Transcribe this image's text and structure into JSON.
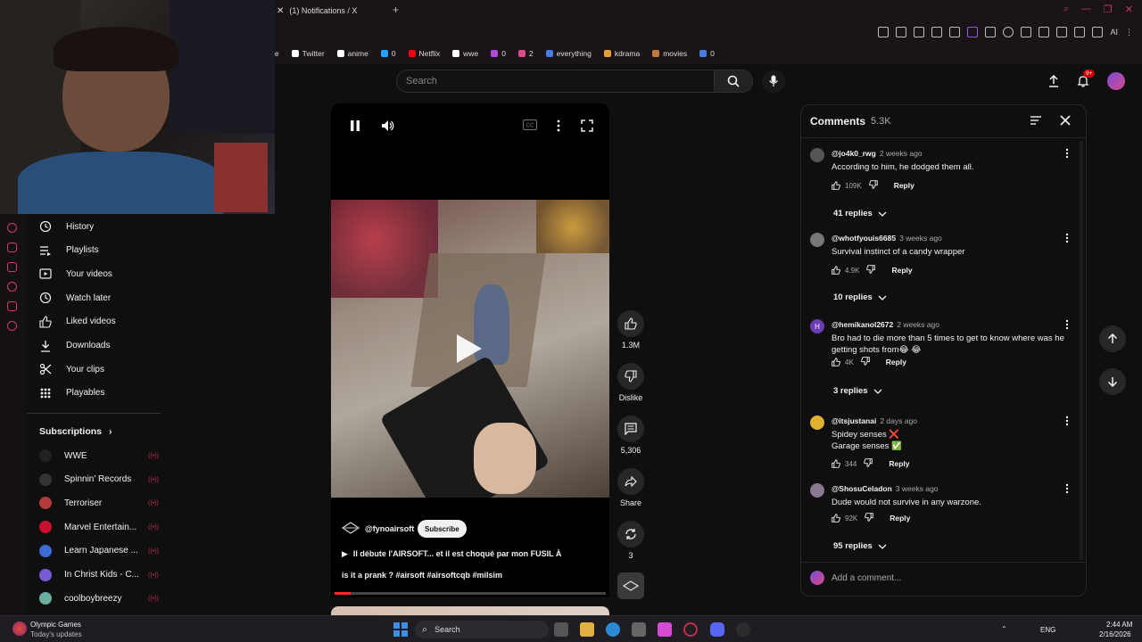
{
  "browser": {
    "tab_title": "(1) Notifications / X",
    "bookmarks": [
      {
        "label": "Twitter",
        "color": "#ffffff"
      },
      {
        "label": "anime",
        "color": "#ffffff"
      },
      {
        "label": "0",
        "color": "#2aa0ff"
      },
      {
        "label": "Netflix",
        "color": "#e50914"
      },
      {
        "label": "wwe",
        "color": "#ffffff"
      },
      {
        "label": "0",
        "color": "#b04bd6"
      },
      {
        "label": "2",
        "color": "#d64b8a"
      },
      {
        "label": "everything",
        "color": "#4b7bd6"
      },
      {
        "label": "kdrama",
        "color": "#e0a040"
      },
      {
        "label": "movies",
        "color": "#c07a40"
      },
      {
        "label": "0",
        "color": "#4b7bd6"
      }
    ],
    "ai_label": "AI"
  },
  "search": {
    "placeholder": "Search"
  },
  "notifications_badge": "9+",
  "sidebar": {
    "items": [
      {
        "label": "History",
        "icon": "history-icon"
      },
      {
        "label": "Playlists",
        "icon": "playlists-icon"
      },
      {
        "label": "Your videos",
        "icon": "your-videos-icon"
      },
      {
        "label": "Watch later",
        "icon": "watch-later-icon"
      },
      {
        "label": "Liked videos",
        "icon": "liked-videos-icon"
      },
      {
        "label": "Downloads",
        "icon": "downloads-icon"
      },
      {
        "label": "Your clips",
        "icon": "clips-icon"
      },
      {
        "label": "Playables",
        "icon": "playables-icon"
      }
    ],
    "subscriptions_title": "Subscriptions",
    "subscriptions": [
      {
        "label": "WWE",
        "color": "#222222"
      },
      {
        "label": "Spinnin' Records",
        "color": "#333333"
      },
      {
        "label": "Terroriser",
        "color": "#b23a3a"
      },
      {
        "label": "Marvel Entertain...",
        "color": "#c8102e"
      },
      {
        "label": "Learn Japanese ...",
        "color": "#3a6bd6"
      },
      {
        "label": "In Christ Kids - C...",
        "color": "#7a5bd6"
      },
      {
        "label": "coolboybreezy",
        "color": "#6ab0a0"
      }
    ]
  },
  "short": {
    "channel": "@fynoairsoft",
    "subscribe_label": "Subscribe",
    "caption_line1": "Il débute l'AIRSOFT... et il est choqué par mon FUSIL À",
    "caption_line2": "is it a prank ? #airsoft #airsoftcqb #milsim",
    "likes": "1.3M",
    "dislike_label": "Dislike",
    "comments_count": "5,306",
    "share_label": "Share",
    "remix_count": "3"
  },
  "comments_panel": {
    "title": "Comments",
    "count": "5.3K",
    "add_placeholder": "Add a comment...",
    "reply_label": "Reply",
    "comments": [
      {
        "user": "@jo4k0_rwg",
        "time": "2 weeks ago",
        "text": "According to him, he dodged them all.",
        "likes": "109K",
        "replies": "41 replies",
        "avatar_color": "#555555",
        "avatar_letter": ""
      },
      {
        "user": "@whotfyouis6685",
        "time": "3 weeks ago",
        "text": "Survival instinct of a candy wrapper",
        "likes": "4.9K",
        "replies": "10 replies",
        "avatar_color": "#777777",
        "avatar_letter": ""
      },
      {
        "user": "@hemikanol2672",
        "time": "2 weeks ago",
        "text": "Bro had to die more than 5 times to get to know where was he getting shots from😂 😂",
        "likes": "4K",
        "replies": "3 replies",
        "avatar_color": "#6a3bb5",
        "avatar_letter": "H"
      },
      {
        "user": "@itsjustanai",
        "time": "2 days ago",
        "text1": "Spidey senses ❌",
        "text2": "Garage senses ✅",
        "likes": "344",
        "replies": "",
        "avatar_color": "#e0b030",
        "avatar_letter": ""
      },
      {
        "user": "@ShosuCeladon",
        "time": "3 weeks ago",
        "text": "Dude would not survive in any warzone.",
        "likes": "92K",
        "replies": "95 replies",
        "avatar_color": "#8a7a90",
        "avatar_letter": ""
      }
    ]
  },
  "taskbar": {
    "weather_title": "Olympic Games",
    "weather_sub": "Today's updates",
    "search_label": "Search",
    "lang": "ENG",
    "time": "2:44 AM",
    "date": "2/16/2026"
  },
  "colors": {
    "accent": "#c0304e",
    "bg": "#0f0f0f",
    "panel_border": "#272727"
  }
}
